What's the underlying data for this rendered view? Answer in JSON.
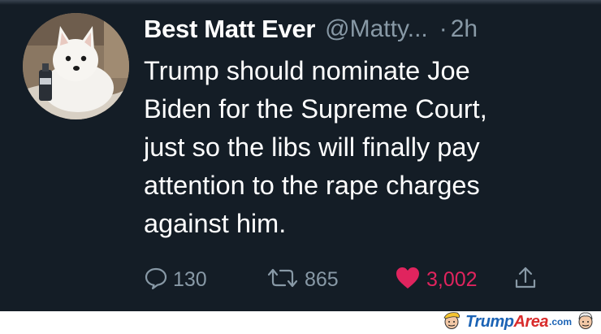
{
  "tweet": {
    "display_name": "Best Matt Ever",
    "handle": "@Matty...",
    "separator": "·",
    "time": "2h",
    "text_lines": [
      "Trump should nominate Joe",
      "Biden for the Supreme Court,",
      "just so the libs will finally pay",
      "attention to the rape charges",
      "against him."
    ],
    "replies": "130",
    "retweets": "865",
    "likes": "3,002",
    "liked": true
  },
  "footer": {
    "logo_trump": "Trump",
    "logo_area": "Area",
    "logo_com": ".com"
  },
  "colors": {
    "background": "#141d26",
    "muted": "#8899a6",
    "like": "#e0245e",
    "text": "#ffffff",
    "logo_blue": "#1b63b5",
    "logo_red": "#d92b2b"
  },
  "icons": {
    "reply": "speech-bubble-icon",
    "retweet": "retweet-arrows-icon",
    "like": "heart-icon",
    "share": "share-upload-icon",
    "avatar": "white-dog-avatar"
  }
}
